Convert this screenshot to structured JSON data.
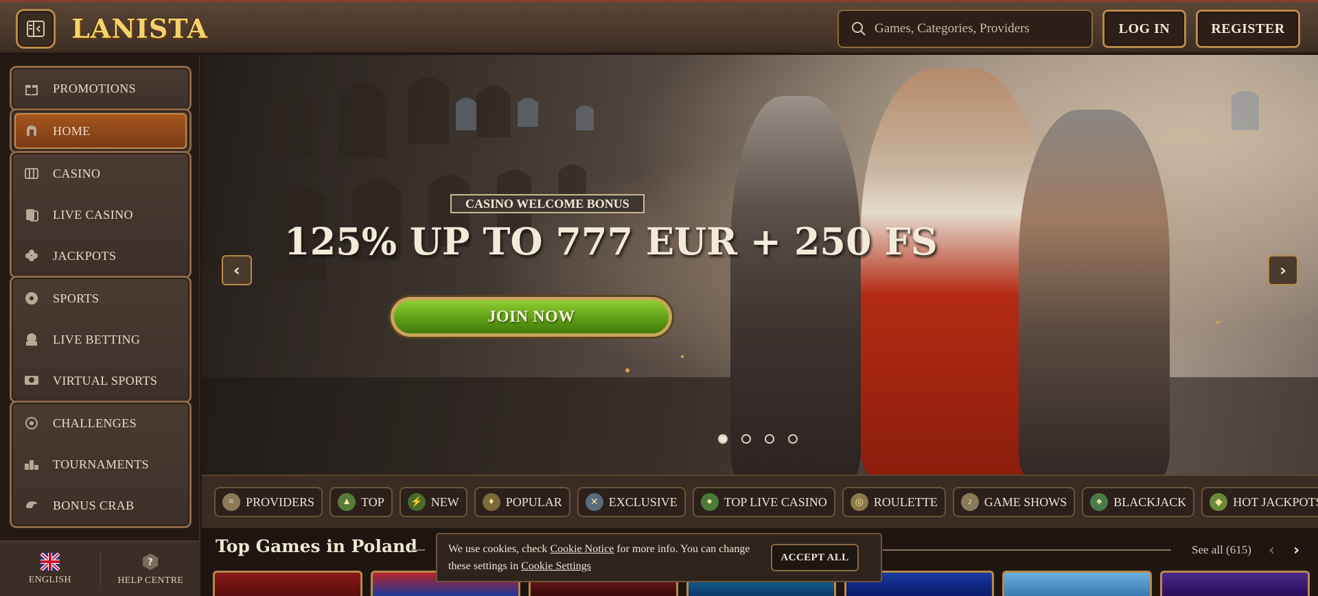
{
  "header": {
    "logo_text": "LANISTA",
    "search_placeholder": "Games, Categories, Providers",
    "login_label": "LOG IN",
    "register_label": "REGISTER"
  },
  "sidebar": {
    "groups": [
      {
        "items": [
          {
            "label": "PROMOTIONS",
            "icon": "gift-icon"
          }
        ]
      },
      {
        "items": [
          {
            "label": "HOME",
            "icon": "helmet-icon",
            "active": true
          }
        ]
      },
      {
        "items": [
          {
            "label": "CASINO",
            "icon": "slot-machine-icon"
          },
          {
            "label": "LIVE CASINO",
            "icon": "cards-icon"
          },
          {
            "label": "JACKPOTS",
            "icon": "clover-icon"
          }
        ]
      },
      {
        "items": [
          {
            "label": "SPORTS",
            "icon": "soccer-ball-icon"
          },
          {
            "label": "LIVE BETTING",
            "icon": "live-icon"
          },
          {
            "label": "VIRTUAL SPORTS",
            "icon": "virtual-sports-icon"
          }
        ]
      },
      {
        "items": [
          {
            "label": "CHALLENGES",
            "icon": "challenge-icon"
          },
          {
            "label": "TOURNAMENTS",
            "icon": "podium-icon"
          },
          {
            "label": "BONUS CRAB",
            "icon": "crab-icon"
          }
        ]
      }
    ],
    "footer": {
      "language_label": "ENGLISH",
      "help_label": "HELP CENTRE"
    }
  },
  "hero": {
    "badge": "CASINO WELCOME BONUS",
    "title": "125% UP TO 777 EUR + 250 FS",
    "cta": "JOIN NOW",
    "slides_total": 4,
    "active_slide": 1
  },
  "categories": [
    {
      "label": "PROVIDERS",
      "icon": "scroll-icon"
    },
    {
      "label": "TOP",
      "icon": "helmet-icon"
    },
    {
      "label": "NEW",
      "icon": "lightning-icon"
    },
    {
      "label": "POPULAR",
      "icon": "torch-icon"
    },
    {
      "label": "EXCLUSIVE",
      "icon": "crossed-swords-icon"
    },
    {
      "label": "TOP LIVE CASINO",
      "icon": "chip-icon"
    },
    {
      "label": "ROULETTE",
      "icon": "roulette-icon"
    },
    {
      "label": "GAME SHOWS",
      "icon": "horn-icon"
    },
    {
      "label": "BLACKJACK",
      "icon": "blackjack-cards-icon"
    },
    {
      "label": "HOT JACKPOTS",
      "icon": "treasure-icon"
    }
  ],
  "games_section": {
    "title": "Top Games in Poland",
    "see_all": "See all (615)"
  },
  "cookie": {
    "text_before": "We use cookies, check ",
    "notice_link": "Cookie Notice",
    "text_middle": " for more info. You can change these settings in ",
    "settings_link": "Cookie Settings",
    "accept_label": "ACCEPT ALL"
  },
  "colors": {
    "accent_gold": "#b88a4a",
    "active_nav": "#a4551e",
    "cta_green": "#5e9f16"
  }
}
